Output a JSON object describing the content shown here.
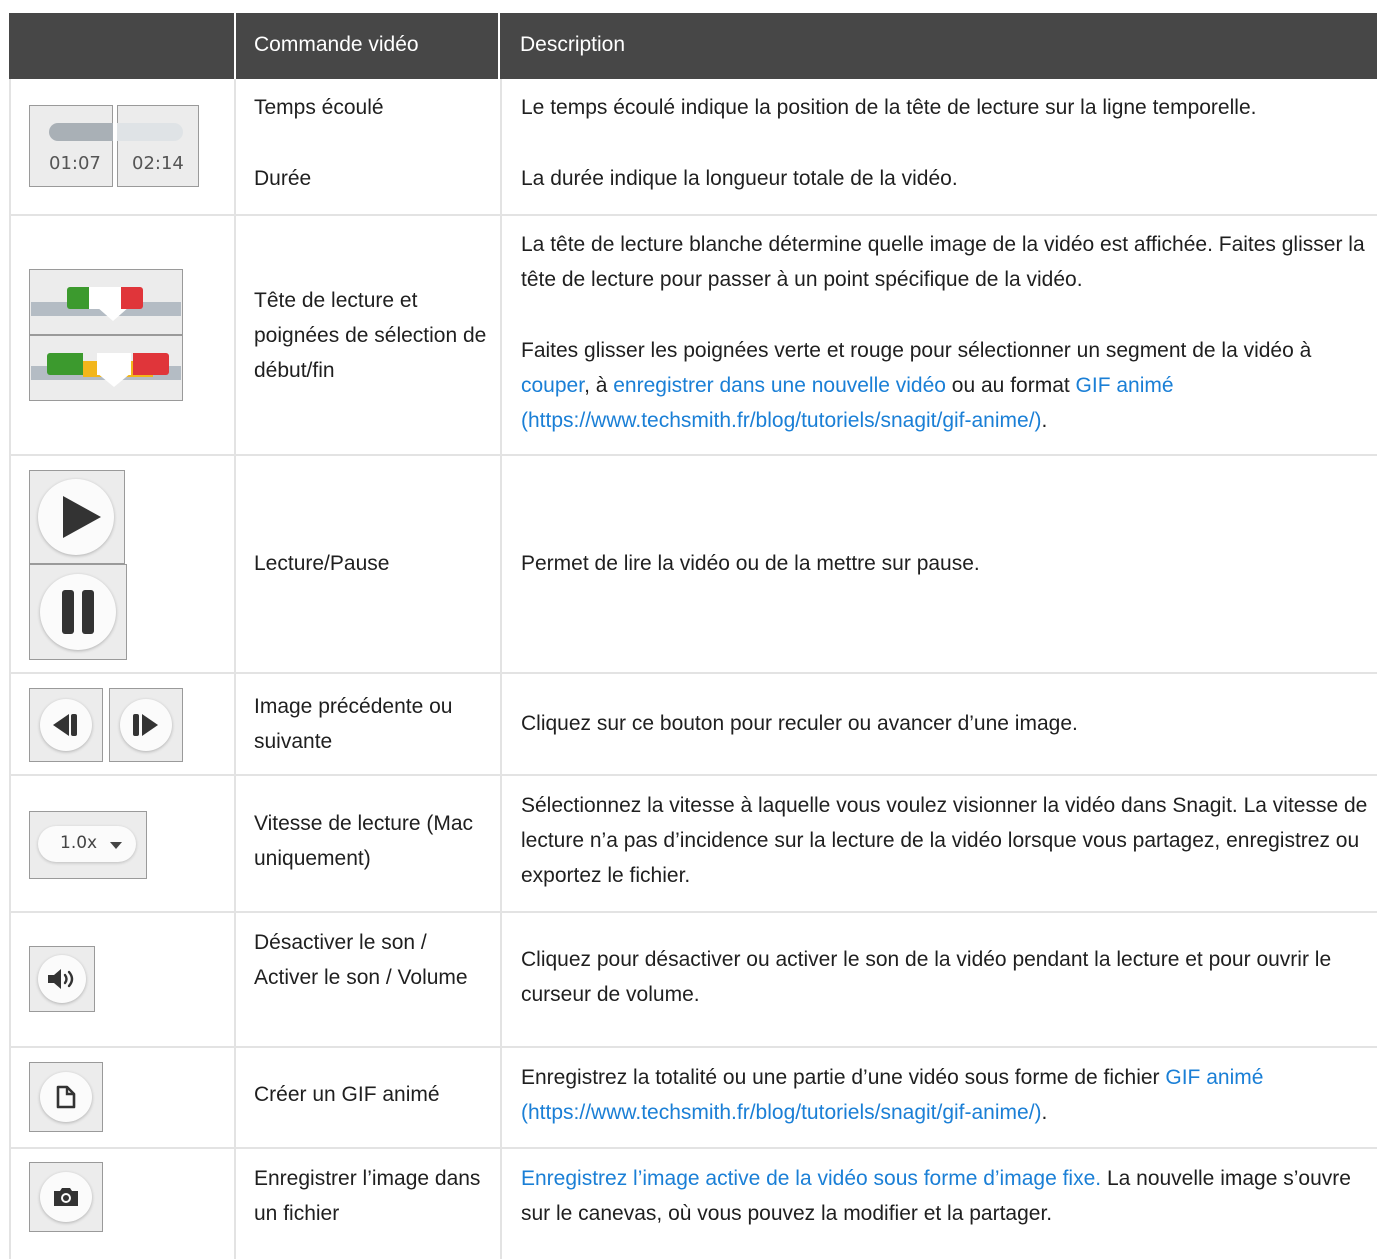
{
  "header": {
    "col1": "",
    "col2": "Commande vidéo",
    "col3": "Description"
  },
  "rows": [
    {
      "icon": "time-display-icon",
      "icon_texts": [
        "01:07",
        "02:14"
      ],
      "commands": [
        "Temps écoulé",
        "Durée"
      ],
      "descriptions": [
        "Le temps écoulé indique la position de la tête de lecture sur la ligne temporelle.",
        "La durée indique la longueur totale de la vidéo."
      ]
    },
    {
      "icon": "playhead-handles-icon",
      "command": "Tête de lecture et poignées de sélection de début/fin",
      "description_1": "La tête de lecture blanche détermine quelle image de la vidéo est affichée. Faites glisser la tête de lecture pour passer à un point spécifique de la vidéo.",
      "description_2": {
        "t1": "Faites glisser les poignées verte et rouge pour sélectionner un segment de la vidéo à ",
        "link1": "couper",
        "t2": ", à ",
        "link2": "enregistrer dans une nouvelle vidéo",
        "t3": " ou au format ",
        "link3": "GIF animé (https://www.techsmith.fr/blog/tutoriels/snagit/gif-anime/)",
        "t4": "."
      }
    },
    {
      "icon": "play-pause-icon",
      "command": "Lecture/Pause",
      "description": "Permet de lire la vidéo ou de la mettre sur pause."
    },
    {
      "icon": "frame-step-icon",
      "command": "Image précédente ou suivante",
      "description": "Cliquez sur ce bouton pour reculer ou avancer d’une image."
    },
    {
      "icon": "playback-speed-icon",
      "icon_text": "1.0x",
      "command": "Vitesse de lecture (Mac uniquement)",
      "description": "Sélectionnez la vitesse à laquelle vous voulez visionner la vidéo dans Snagit. La vitesse de lecture n’a pas d’incidence sur la lecture de la vidéo lorsque vous partagez, enregistrez ou exportez le fichier."
    },
    {
      "icon": "volume-icon",
      "command": "Désactiver le son / Activer le son / Volume",
      "description": "Cliquez pour désactiver ou activer le son de la vidéo pendant la lecture et pour ouvrir le curseur de volume."
    },
    {
      "icon": "gif-file-icon",
      "command": "Créer un GIF animé",
      "description": {
        "t1": "Enregistrez la totalité ou une partie d’une vidéo sous forme de fichier ",
        "link1": "GIF animé (https://www.techsmith.fr/blog/tutoriels/snagit/gif-anime/)",
        "t2": "."
      }
    },
    {
      "icon": "camera-icon",
      "command": "Enregistrer l’image dans un fichier",
      "description": {
        "link1": "Enregistrez l’image active de la vidéo sous forme d’image fixe.",
        "t1": " La nouvelle image s’ouvre sur le canevas, où vous pouvez la modifier et la partager."
      }
    }
  ],
  "colors": {
    "header_bg": "#474747",
    "link": "#1a7fd6",
    "border": "#e3e3e3",
    "green_handle": "#3c9a2e",
    "red_handle": "#e0353a",
    "yellow_selection": "#f2b61b"
  }
}
